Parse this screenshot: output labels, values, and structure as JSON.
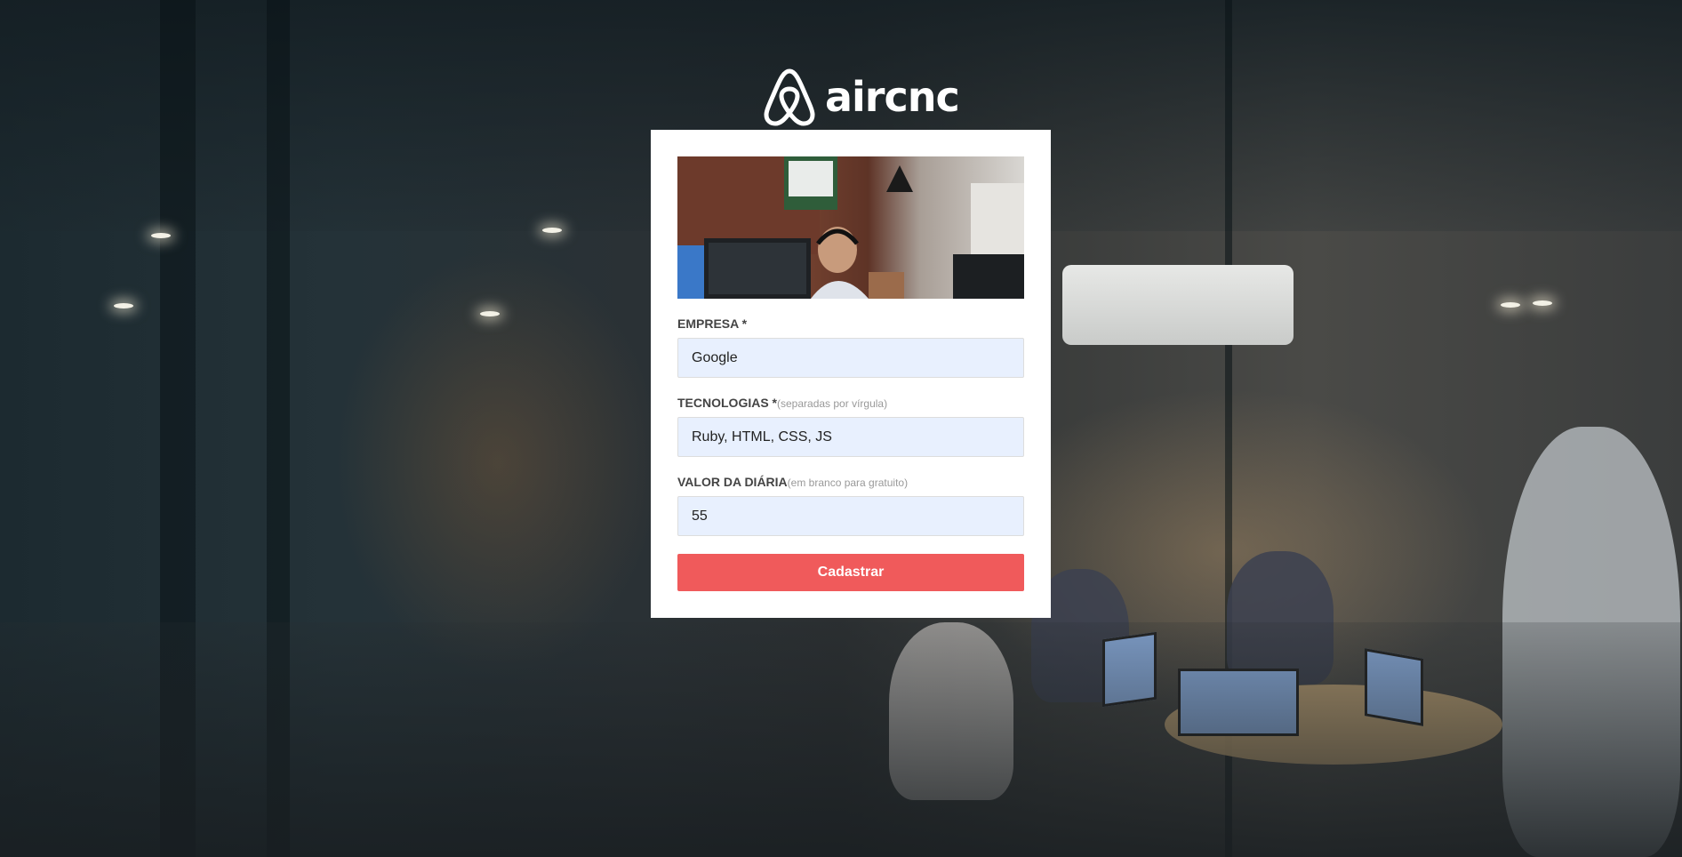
{
  "brand": {
    "name": "aircnc",
    "logo_icon": "airbnb-belo-icon"
  },
  "form": {
    "company": {
      "label": "EMPRESA *",
      "value": "Google"
    },
    "techs": {
      "label": "TECNOLOGIAS *",
      "hint": "(separadas por vírgula)",
      "value": "Ruby, HTML, CSS, JS"
    },
    "price": {
      "label": "VALOR DA DIÁRIA",
      "hint": "(em branco para gratuito)",
      "value": "55"
    },
    "submit_label": "Cadastrar"
  },
  "colors": {
    "accent": "#f05a5b",
    "input_bg": "#e8f0fe",
    "card_bg": "#ffffff"
  }
}
